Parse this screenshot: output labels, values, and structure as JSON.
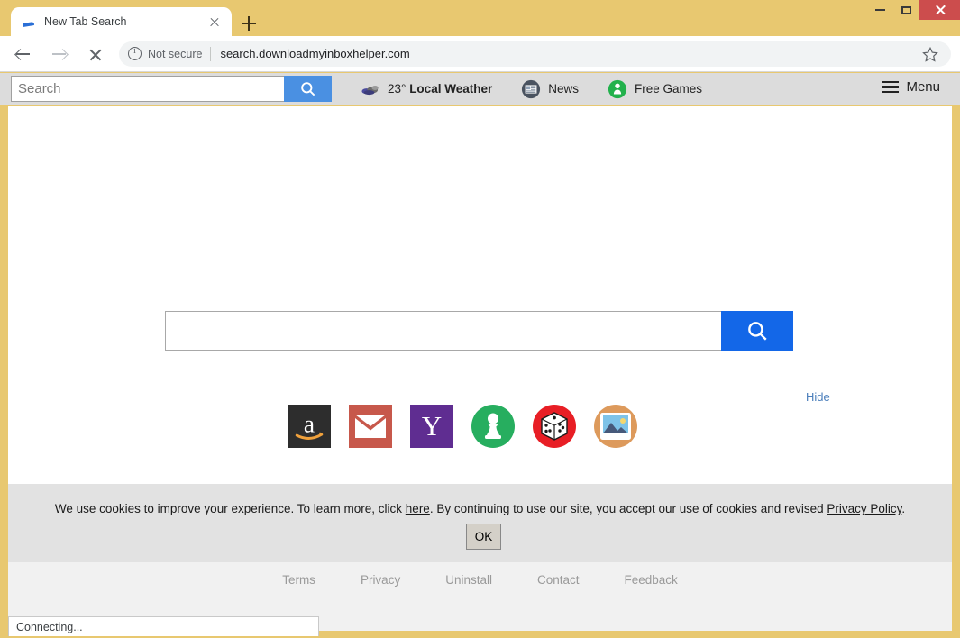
{
  "browser": {
    "tab": {
      "title": "New Tab Search",
      "favicon": "blue-swoosh-favicon",
      "close_label": "×"
    },
    "new_tab_label": "+",
    "window_controls": {
      "minimize": "minimize-icon",
      "maximize": "maximize-icon",
      "close": "close-icon"
    },
    "nav": {
      "back": "back-arrow-icon",
      "forward": "forward-arrow-icon",
      "stop": "stop-loading-icon",
      "security_label": "Not secure",
      "url": "search.downloadmyinboxhelper.com",
      "bookmark": "star-icon"
    }
  },
  "hijacker_toolbar": {
    "search_placeholder": "Search",
    "search_value": "",
    "search_button": "search-icon",
    "weather": {
      "icon": "cloud-icon",
      "temperature": "23°",
      "label": "Local Weather"
    },
    "news": {
      "icon": "newspaper-icon",
      "label": "News"
    },
    "free_games": {
      "icon": "pawn-person-icon",
      "label": "Free Games"
    },
    "menu": {
      "icon": "hamburger-icon",
      "label": "Menu"
    }
  },
  "main": {
    "search_placeholder": "",
    "search_value": "",
    "search_button": "search-icon",
    "hide_label": "Hide",
    "shortcuts": [
      {
        "name": "amazon",
        "label": "Amazon"
      },
      {
        "name": "gmail",
        "label": "Gmail"
      },
      {
        "name": "yahoo",
        "label": "Yahoo"
      },
      {
        "name": "games",
        "label": "Games"
      },
      {
        "name": "dice",
        "label": "Dice"
      },
      {
        "name": "photos",
        "label": "Photos"
      }
    ]
  },
  "cookie_banner": {
    "text_1": "We use cookies to improve your experience. To learn more, click ",
    "link_here": "here",
    "text_2": ". By continuing to use our site, you accept our use of cookies and revised ",
    "link_privacy": "Privacy Policy",
    "text_3": ".",
    "ok_label": "OK"
  },
  "footer": {
    "links": [
      {
        "label": "Terms"
      },
      {
        "label": "Privacy"
      },
      {
        "label": "Uninstall"
      },
      {
        "label": "Contact"
      },
      {
        "label": "Feedback"
      }
    ]
  },
  "status_bar": {
    "text": "Connecting..."
  },
  "colors": {
    "window_frame": "#e8c870",
    "toolbar_bg": "#dcdcdc",
    "toolbar_search_button": "#4a90e2",
    "main_search_button": "#1367e8",
    "hide_link": "#4a7ebb",
    "cookie_bg": "#e2e2e2",
    "footer_bg": "#f1f1f1",
    "close_button": "#cc4d4d"
  }
}
